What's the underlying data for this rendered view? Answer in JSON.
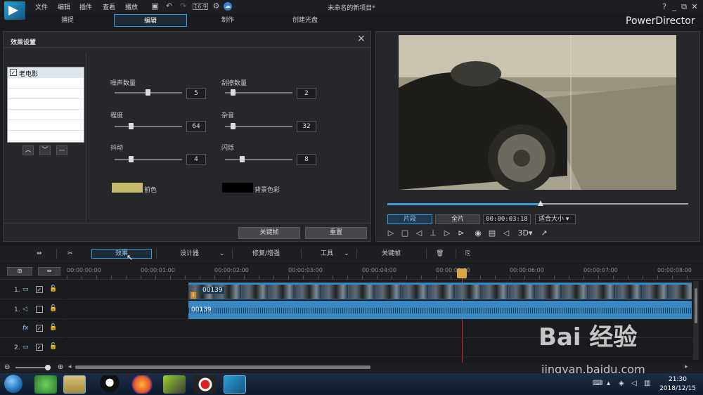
{
  "menu": {
    "items": [
      "文件",
      "编辑",
      "插件",
      "查看",
      "播放"
    ]
  },
  "document_title": "未命名的新项目*",
  "window_controls": [
    "?",
    "_",
    "⧉",
    "✕"
  ],
  "tabs": [
    "捕捉",
    "编辑",
    "制作",
    "创建光盘"
  ],
  "brand": "PowerDirector",
  "effects_panel": {
    "title": "效果设置",
    "list": [
      {
        "label": "老电影",
        "checked": true
      }
    ],
    "sliders": [
      {
        "label": "噪声数量",
        "value": "5",
        "level": 0.5
      },
      {
        "label": "刮擦数量",
        "value": "2",
        "level": 0.1
      },
      {
        "label": "程度",
        "value": "64",
        "level": 0.25
      },
      {
        "label": "杂音",
        "value": "32",
        "level": 0.1
      },
      {
        "label": "抖动",
        "value": "4",
        "level": 0.25
      },
      {
        "label": "闪烁",
        "value": "8",
        "level": 0.25
      }
    ],
    "fg_color": {
      "label": "前色",
      "hex": "#c7b96a"
    },
    "bg_color": {
      "label": "背景色彩",
      "hex": "#000000"
    },
    "keyframe_button": "关键帧",
    "reset_button": "重置"
  },
  "preview": {
    "mode_clip": "片段",
    "mode_full": "全片",
    "timecode": "00:00:03:18",
    "fit": "适合大小",
    "threed": "3D",
    "progress": 0.51
  },
  "toolbar": {
    "effect": "效果",
    "designer": "设计器",
    "fix": "修复/增强",
    "tools": "工具",
    "keyframe": "关键帧"
  },
  "ruler": [
    "00:00:00:00",
    "00:00:01:00",
    "00:00:02:00",
    "00:00:03:00",
    "00:00:04:00",
    "00:00:05:00",
    "00:00:06:00",
    "00:00:07:00",
    "00:00:08:00"
  ],
  "tracks": [
    {
      "num": "1.",
      "icon": "video-track-icon"
    },
    {
      "num": "1.",
      "icon": "audio-track-icon"
    },
    {
      "num": "",
      "icon": "fx-track-icon",
      "fx": "fx"
    },
    {
      "num": "2.",
      "icon": "video-track-icon"
    }
  ],
  "clips": {
    "video_label": "00139",
    "audio_label": "00139"
  },
  "taskbar": {
    "time": "21:30",
    "date": "2018/12/15"
  },
  "watermark": {
    "main": "Bai 经验",
    "url": "jingyan.baidu.com"
  }
}
